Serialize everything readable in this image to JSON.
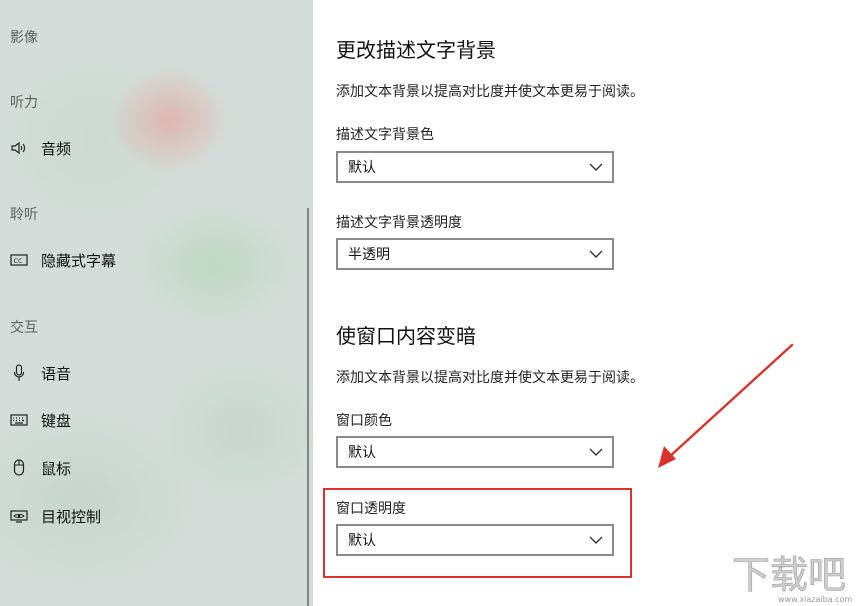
{
  "sidebar": {
    "sections": {
      "vision": "影像",
      "hearing": "听力",
      "listening": "聆听",
      "interaction": "交互"
    },
    "items": {
      "audio": {
        "label": "音频",
        "icon": "speaker-icon"
      },
      "captions": {
        "label": "隐藏式字幕",
        "icon": "closed-captions-icon"
      },
      "speech": {
        "label": "语音",
        "icon": "microphone-icon"
      },
      "keyboard": {
        "label": "键盘",
        "icon": "keyboard-icon"
      },
      "mouse": {
        "label": "鼠标",
        "icon": "mouse-icon"
      },
      "eye_control": {
        "label": "目视控制",
        "icon": "eye-control-icon"
      }
    }
  },
  "main": {
    "section1": {
      "title": "更改描述文字背景",
      "description": "添加文本背景以提高对比度并使文本更易于阅读。",
      "bg_color": {
        "label": "描述文字背景色",
        "value": "默认"
      },
      "bg_opacity": {
        "label": "描述文字背景透明度",
        "value": "半透明"
      }
    },
    "section2": {
      "title": "使窗口内容变暗",
      "description": "添加文本背景以提高对比度并使文本更易于阅读。",
      "window_color": {
        "label": "窗口颜色",
        "value": "默认"
      },
      "window_opacity": {
        "label": "窗口透明度",
        "value": "默认"
      }
    }
  },
  "annotation": {
    "highlight_color": "#d9342b"
  },
  "watermark": {
    "text": "下载吧",
    "subtext": "www.xiazaiba.com"
  }
}
